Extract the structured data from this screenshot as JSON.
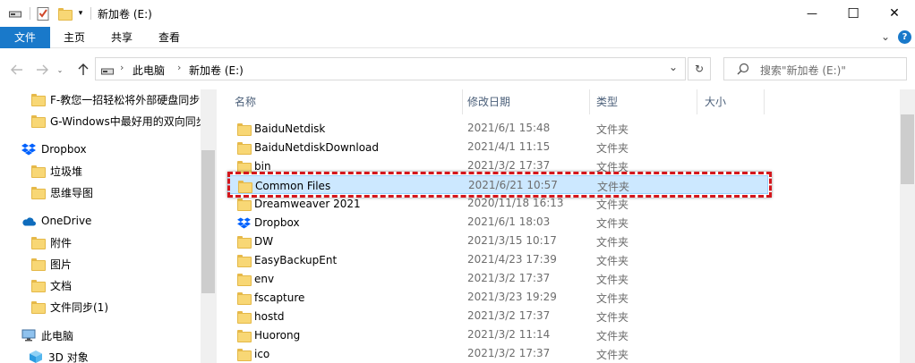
{
  "window": {
    "title": "新加卷 (E:)",
    "minimize_glyph": "—",
    "maximize_glyph": "☐",
    "close_glyph": "✕"
  },
  "ribbon": {
    "tabs": [
      "文件",
      "主页",
      "共享",
      "查看"
    ],
    "expand_glyph": "⌄",
    "help_glyph": "?"
  },
  "address": {
    "crumbs": [
      "此电脑",
      "新加卷 (E:)"
    ],
    "separator": "›",
    "dropdown_glyph": "⌄",
    "refresh_glyph": "↻",
    "search_placeholder": "搜索\"新加卷 (E:)\""
  },
  "nav": {
    "items": [
      {
        "label": "F-教您一招轻松将外部硬盘同步到",
        "icon": "folder-icon"
      },
      {
        "label": "G-Windows中最好用的双向同步",
        "icon": "folder-icon"
      },
      {
        "label": "Dropbox",
        "icon": "dropbox-icon"
      },
      {
        "label": "垃圾堆",
        "icon": "folder-icon"
      },
      {
        "label": "思维导图",
        "icon": "folder-icon"
      },
      {
        "label": "OneDrive",
        "icon": "onedrive-icon"
      },
      {
        "label": "附件",
        "icon": "folder-icon"
      },
      {
        "label": "图片",
        "icon": "folder-icon"
      },
      {
        "label": "文档",
        "icon": "folder-icon"
      },
      {
        "label": "文件同步(1)",
        "icon": "folder-icon"
      },
      {
        "label": "此电脑",
        "icon": "computer-icon"
      },
      {
        "label": "3D 对象",
        "icon": "cube-icon"
      }
    ]
  },
  "list": {
    "columns": [
      "名称",
      "修改日期",
      "类型",
      "大小"
    ],
    "sort_glyph": "^",
    "rows": [
      {
        "name": "BaiduNetdisk",
        "date": "2021/6/1 15:48",
        "type": "文件夹",
        "icon": "folder-icon"
      },
      {
        "name": "BaiduNetdiskDownload",
        "date": "2021/4/1 11:15",
        "type": "文件夹",
        "icon": "folder-icon"
      },
      {
        "name": "bin",
        "date": "2021/3/2 17:37",
        "type": "文件夹",
        "icon": "folder-icon"
      },
      {
        "name": "Common Files",
        "date": "2021/6/21 10:57",
        "type": "文件夹",
        "icon": "folder-icon"
      },
      {
        "name": "Dreamweaver 2021",
        "date": "2020/11/18 16:13",
        "type": "文件夹",
        "icon": "folder-icon"
      },
      {
        "name": "Dropbox",
        "date": "2021/6/1 18:03",
        "type": "文件夹",
        "icon": "dropbox-icon"
      },
      {
        "name": "DW",
        "date": "2021/3/15 10:17",
        "type": "文件夹",
        "icon": "folder-icon"
      },
      {
        "name": "EasyBackupEnt",
        "date": "2021/4/23 17:39",
        "type": "文件夹",
        "icon": "folder-icon"
      },
      {
        "name": "env",
        "date": "2021/3/2 17:37",
        "type": "文件夹",
        "icon": "folder-icon"
      },
      {
        "name": "fscapture",
        "date": "2021/3/23 19:29",
        "type": "文件夹",
        "icon": "folder-icon"
      },
      {
        "name": "hostd",
        "date": "2021/3/2 17:37",
        "type": "文件夹",
        "icon": "folder-icon"
      },
      {
        "name": "Huorong",
        "date": "2021/3/2 11:14",
        "type": "文件夹",
        "icon": "folder-icon"
      },
      {
        "name": "ico",
        "date": "2021/3/2 17:37",
        "type": "文件夹",
        "icon": "folder-icon"
      }
    ]
  },
  "colors": {
    "accent": "#1979ca",
    "selection": "#cce8ff",
    "highlight": "#d4161c"
  }
}
